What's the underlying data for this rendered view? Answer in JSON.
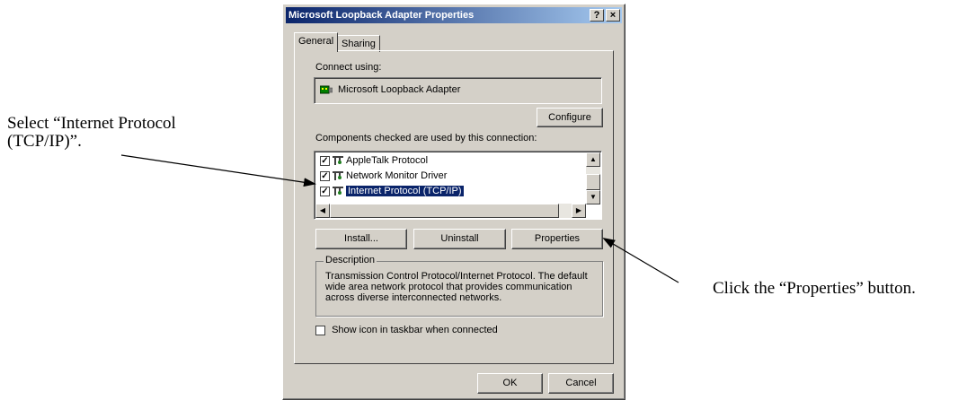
{
  "annotations": {
    "left_callout_line1": "Select “Internet Protocol",
    "left_callout_line2": "(TCP/IP)”.",
    "right_callout": "Click the “Properties” button."
  },
  "dialog": {
    "title": "Microsoft Loopback Adapter Properties",
    "help_btn": "?",
    "close_btn": "×",
    "tabs": [
      "General",
      "Sharing"
    ],
    "connect_using_label": "Connect using:",
    "adapter_name": "Microsoft Loopback Adapter",
    "configure_label": "Configure",
    "components_label": "Components checked are used by this connection:",
    "components": [
      {
        "label": "AppleTalk Protocol",
        "checked": true,
        "selected": false
      },
      {
        "label": "Network Monitor Driver",
        "checked": true,
        "selected": false
      },
      {
        "label": "Internet Protocol (TCP/IP)",
        "checked": true,
        "selected": true
      }
    ],
    "install_label": "Install...",
    "uninstall_label": "Uninstall",
    "properties_label": "Properties",
    "description_title": "Description",
    "description_text": "Transmission Control Protocol/Internet Protocol. The default wide area network protocol that provides communication across diverse interconnected networks.",
    "show_icon_label": "Show icon in taskbar when connected",
    "show_icon_checked": false,
    "ok_label": "OK",
    "cancel_label": "Cancel"
  }
}
